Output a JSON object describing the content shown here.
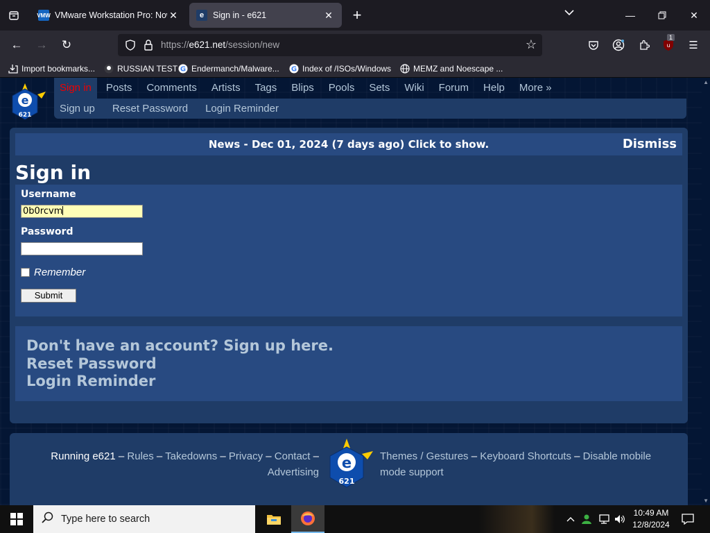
{
  "browser": {
    "tabs": [
      {
        "title": "VMware Workstation Pro: Now",
        "active": false,
        "favicon": "vmware-icon",
        "favicon_text": "VMW"
      },
      {
        "title": "Sign in - e621",
        "active": true,
        "favicon": "e621-icon",
        "favicon_text": "e"
      }
    ],
    "url_prefix": "https://",
    "url_domain": "e621.net",
    "url_path": "/session/new",
    "extension_badge": "1",
    "bookmarks": [
      {
        "label": "Import bookmarks...",
        "icon": "import-icon"
      },
      {
        "label": "RUSSIAN TEST",
        "icon": "github-icon"
      },
      {
        "label": "Endermanch/Malware...",
        "icon": "google-icon"
      },
      {
        "label": "Index of /ISOs/Windows",
        "icon": "google-icon"
      },
      {
        "label": "MEMZ and Noescape ...",
        "icon": "globe-icon"
      }
    ]
  },
  "site": {
    "nav_primary": [
      "Sign in",
      "Posts",
      "Comments",
      "Artists",
      "Tags",
      "Blips",
      "Pools",
      "Sets",
      "Wiki",
      "Forum",
      "Help",
      "More »"
    ],
    "nav_secondary": [
      "Sign up",
      "Reset Password",
      "Login Reminder"
    ],
    "news": "News - Dec 01, 2024 (7 days ago) Click to show.",
    "dismiss": "Dismiss",
    "heading": "Sign in",
    "form": {
      "username_label": "Username",
      "username_value": "0b0rcvm",
      "password_label": "Password",
      "password_value": "",
      "remember_label": "Remember",
      "remember_checked": false,
      "submit_label": "Submit"
    },
    "help_links": [
      "Don't have an account? Sign up here.",
      "Reset Password",
      "Login Reminder"
    ],
    "footer": {
      "running": "Running e621",
      "left_links": [
        "Rules",
        "Takedowns",
        "Privacy",
        "Contact",
        "Advertising"
      ],
      "right_links": [
        "Themes / Gestures",
        "Keyboard Shortcuts",
        "Disable mobile mode support"
      ],
      "separator": "–"
    },
    "colors": {
      "accent": "#b4c7d9",
      "current_nav": "#e00000",
      "panel": "#1f3c67",
      "section": "#284a81"
    }
  },
  "taskbar": {
    "search_placeholder": "Type here to search",
    "time": "10:49 AM",
    "date": "12/8/2024"
  }
}
